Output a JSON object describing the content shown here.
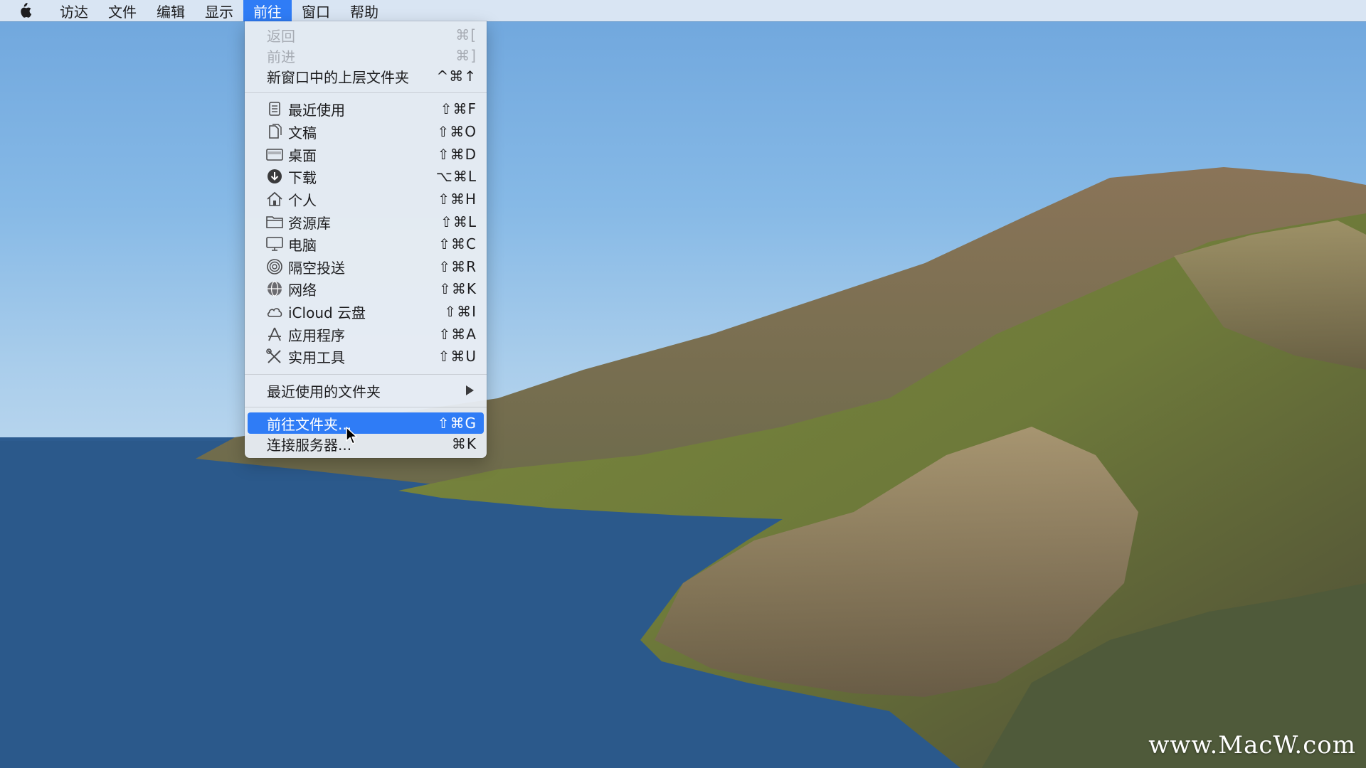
{
  "menubar": {
    "items": [
      "访达",
      "文件",
      "编辑",
      "显示",
      "前往",
      "窗口",
      "帮助"
    ],
    "active": "前往"
  },
  "go_menu": {
    "items": [
      {
        "label": "返回",
        "shortcut": "⌘[",
        "disabled": true
      },
      {
        "label": "前进",
        "shortcut": "⌘]",
        "disabled": true
      },
      {
        "label": "新窗口中的上层文件夹",
        "shortcut": "^⌘↑"
      },
      {
        "label": "最近使用",
        "shortcut": "⇧⌘F",
        "icon": "recents-icon"
      },
      {
        "label": "文稿",
        "shortcut": "⇧⌘O",
        "icon": "documents-icon"
      },
      {
        "label": "桌面",
        "shortcut": "⇧⌘D",
        "icon": "desktop-icon"
      },
      {
        "label": "下载",
        "shortcut": "⌥⌘L",
        "icon": "downloads-icon"
      },
      {
        "label": "个人",
        "shortcut": "⇧⌘H",
        "icon": "home-icon"
      },
      {
        "label": "资源库",
        "shortcut": "⇧⌘L",
        "icon": "folder-icon"
      },
      {
        "label": "电脑",
        "shortcut": "⇧⌘C",
        "icon": "computer-icon"
      },
      {
        "label": "隔空投送",
        "shortcut": "⇧⌘R",
        "icon": "airdrop-icon"
      },
      {
        "label": "网络",
        "shortcut": "⇧⌘K",
        "icon": "network-icon"
      },
      {
        "label": "iCloud 云盘",
        "shortcut": "⇧⌘I",
        "icon": "icloud-icon"
      },
      {
        "label": "应用程序",
        "shortcut": "⇧⌘A",
        "icon": "applications-icon"
      },
      {
        "label": "实用工具",
        "shortcut": "⇧⌘U",
        "icon": "utilities-icon"
      },
      {
        "label": "最近使用的文件夹",
        "submenu": true
      },
      {
        "label": "前往文件夹...",
        "shortcut": "⇧⌘G",
        "highlighted": true
      },
      {
        "label": "连接服务器...",
        "shortcut": "⌘K"
      }
    ]
  },
  "watermark": "www.MacW.com",
  "colors": {
    "highlight": "#2f7cf6",
    "menu_bg": "#e7ecf3"
  }
}
